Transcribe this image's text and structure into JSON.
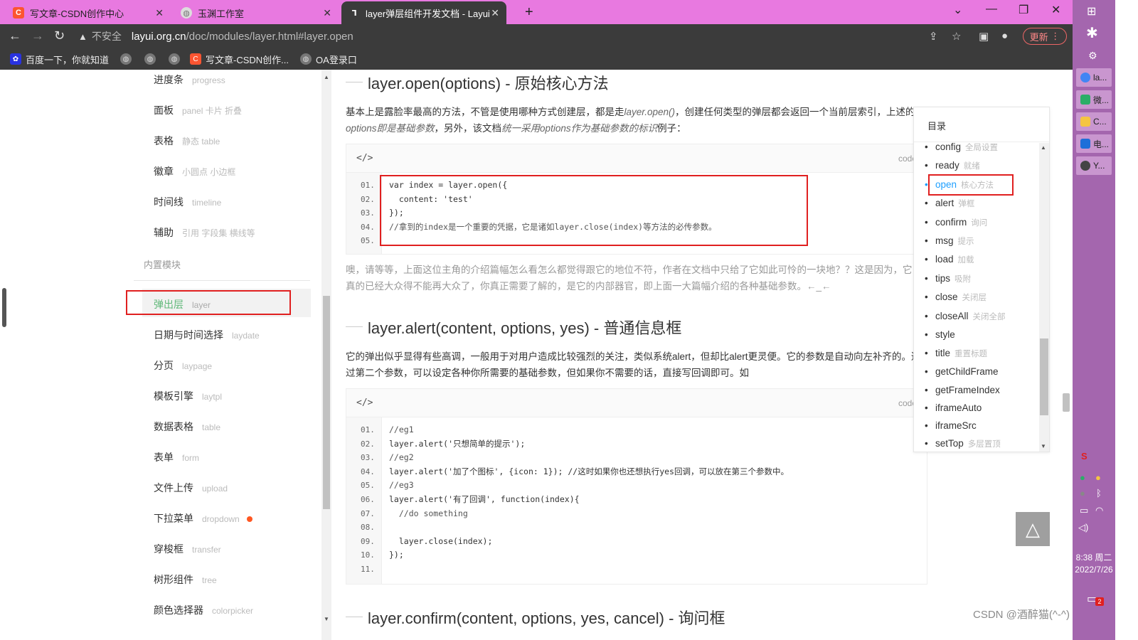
{
  "browser": {
    "tabs": [
      {
        "title": "写文章-CSDN创作中心",
        "icon": "csdn-icon",
        "active": false
      },
      {
        "title": "玉渊工作室",
        "icon": "globe-icon",
        "active": false
      },
      {
        "title": "layer弹层组件开发文档 - Layui",
        "icon": "layui-icon",
        "active": true
      }
    ],
    "security_label": "不安全",
    "url_domain": "layui.org.cn",
    "url_path": "/doc/modules/layer.html#layer.open",
    "update_label": "更新",
    "bookmarks": [
      {
        "label": "百度一下，你就知道",
        "icon": "baidu-icon"
      },
      {
        "label": "",
        "icon": "globe-icon"
      },
      {
        "label": "",
        "icon": "globe-icon"
      },
      {
        "label": "",
        "icon": "globe-icon"
      },
      {
        "label": "写文章-CSDN创作...",
        "icon": "csdn-icon"
      },
      {
        "label": "OA登录口",
        "icon": "globe-icon"
      }
    ]
  },
  "sidebar": {
    "items": [
      {
        "label": "进度条",
        "sub": "progress"
      },
      {
        "label": "面板",
        "sub": "panel 卡片 折叠"
      },
      {
        "label": "表格",
        "sub": "静态 table"
      },
      {
        "label": "徽章",
        "sub": "小圆点 小边框"
      },
      {
        "label": "时间线",
        "sub": "timeline"
      },
      {
        "label": "辅助",
        "sub": "引用 字段集 横线等"
      }
    ],
    "section_title": "内置模块",
    "modules": [
      {
        "label": "弹出层",
        "sub": "layer",
        "active": true
      },
      {
        "label": "日期与时间选择",
        "sub": "laydate"
      },
      {
        "label": "分页",
        "sub": "laypage"
      },
      {
        "label": "模板引擎",
        "sub": "laytpl"
      },
      {
        "label": "数据表格",
        "sub": "table"
      },
      {
        "label": "表单",
        "sub": "form"
      },
      {
        "label": "文件上传",
        "sub": "upload"
      },
      {
        "label": "下拉菜单",
        "sub": "dropdown",
        "dot": true
      },
      {
        "label": "穿梭框",
        "sub": "transfer"
      },
      {
        "label": "树形组件",
        "sub": "tree"
      },
      {
        "label": "颜色选择器",
        "sub": "colorpicker"
      }
    ]
  },
  "content": {
    "open_heading": "layer.open(options) - 原始核心方法",
    "open_para": {
      "t1": "基本上是露脸率最高的方法，不管是使用哪种方式创建层，都是走",
      "i1": "layer.open()",
      "t2": "，创建任何类型的弹层都会返回一个当前层索引，上述的",
      "i2": "options即是基础参数",
      "t3": "，另外，该文档",
      "i3": "统一采用options作为基础参数的标识",
      "t4": "例子："
    },
    "code_header_left": "</>",
    "code_header_right": "code",
    "code1": [
      {
        "n": "01.",
        "text": "var index = layer.open({"
      },
      {
        "n": "02.",
        "text": "  content: 'test'"
      },
      {
        "n": "03.",
        "text": "});"
      },
      {
        "n": "04.",
        "text": "//拿到的index是一个重要的凭据，它是诸如layer.close(index)等方法的必传参数。"
      },
      {
        "n": "05.",
        "text": ""
      }
    ],
    "gray_para": "噢，请等等，上面这位主角的介绍篇幅怎么看怎么都觉得跟它的地位不符，作者在文档中只给了它如此可怜的一块地？？这是因为，它真的已经大众得不能再大众了，你真正需要了解的，是它的内部器官，即上面一大篇幅介绍的各种基础参数。←_←",
    "alert_heading": "layer.alert(content, options, yes) - 普通信息框",
    "alert_para": "它的弹出似乎显得有些高调，一般用于对用户造成比较强烈的关注，类似系统alert，但却比alert更灵便。它的参数是自动向左补齐的。通过第二个参数，可以设定各种你所需要的基础参数，但如果你不需要的话，直接写回调即可。如",
    "code2": [
      {
        "n": "01.",
        "text": "//eg1"
      },
      {
        "n": "02.",
        "text": "layer.alert('只想简单的提示');"
      },
      {
        "n": "03.",
        "text": "//eg2"
      },
      {
        "n": "04.",
        "text": "layer.alert('加了个图标', {icon: 1}); //这时如果你也还想执行yes回调，可以放在第三个参数中。"
      },
      {
        "n": "05.",
        "text": "//eg3"
      },
      {
        "n": "06.",
        "text": "layer.alert('有了回调', function(index){"
      },
      {
        "n": "07.",
        "text": "  //do something"
      },
      {
        "n": "08.",
        "text": ""
      },
      {
        "n": "09.",
        "text": "  layer.close(index);"
      },
      {
        "n": "10.",
        "text": "});"
      },
      {
        "n": "11.",
        "text": ""
      }
    ],
    "confirm_heading": "layer.confirm(content, options, yes, cancel) - 询问框"
  },
  "toc": {
    "title": "目录",
    "items": [
      {
        "label": "config",
        "sub": "全局设置"
      },
      {
        "label": "ready",
        "sub": "就绪"
      },
      {
        "label": "open",
        "sub": "核心方法",
        "active": true
      },
      {
        "label": "alert",
        "sub": "弹框"
      },
      {
        "label": "confirm",
        "sub": "询问"
      },
      {
        "label": "msg",
        "sub": "提示"
      },
      {
        "label": "load",
        "sub": "加载"
      },
      {
        "label": "tips",
        "sub": "吸附"
      },
      {
        "label": "close",
        "sub": "关闭层"
      },
      {
        "label": "closeAll",
        "sub": "关闭全部"
      },
      {
        "label": "style",
        "sub": ""
      },
      {
        "label": "title",
        "sub": "重置标题"
      },
      {
        "label": "getChildFrame",
        "sub": ""
      },
      {
        "label": "getFrameIndex",
        "sub": ""
      },
      {
        "label": "iframeAuto",
        "sub": ""
      },
      {
        "label": "iframeSrc",
        "sub": ""
      },
      {
        "label": "setTop",
        "sub": "多层置顶"
      }
    ]
  },
  "watermark": "CSDN @酒醉猫(^-^)",
  "taskbar": {
    "apps": [
      {
        "label": "la...",
        "color": "#4285f4"
      },
      {
        "label": "微...",
        "color": "#2aae67"
      },
      {
        "label": "C...",
        "color": "#f5c542"
      },
      {
        "label": "电...",
        "color": "#1e6fd9"
      },
      {
        "label": "Y...",
        "color": "#444444"
      }
    ],
    "time": "8:38 周二",
    "date": "2022/7/26",
    "notifications": "2"
  }
}
